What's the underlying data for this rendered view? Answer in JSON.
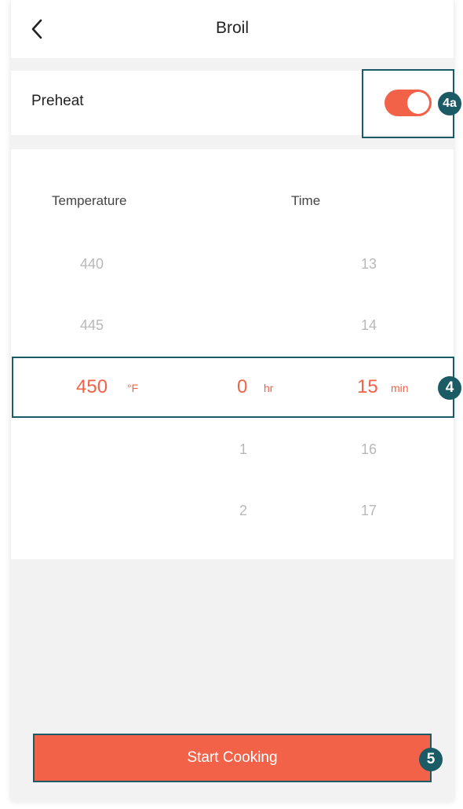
{
  "header": {
    "title": "Broil",
    "back_icon": "chevron-left-icon"
  },
  "preheat": {
    "label": "Preheat",
    "enabled": true,
    "badge": "4a"
  },
  "picker": {
    "temperature_label": "Temperature",
    "time_label": "Time",
    "temperature": {
      "above": [
        "440",
        "445"
      ],
      "selected": "450",
      "unit": "°F",
      "below": []
    },
    "hours": {
      "above": [],
      "selected": "0",
      "unit": "hr",
      "below": [
        "1",
        "2"
      ]
    },
    "minutes": {
      "above": [
        "13",
        "14"
      ],
      "selected": "15",
      "unit": "min",
      "below": [
        "16",
        "17"
      ]
    },
    "badge": "4"
  },
  "footer": {
    "start_label": "Start Cooking",
    "badge": "5"
  },
  "colors": {
    "accent": "#f26249",
    "annotation": "#1b5b66",
    "background": "#f2f2f2"
  }
}
